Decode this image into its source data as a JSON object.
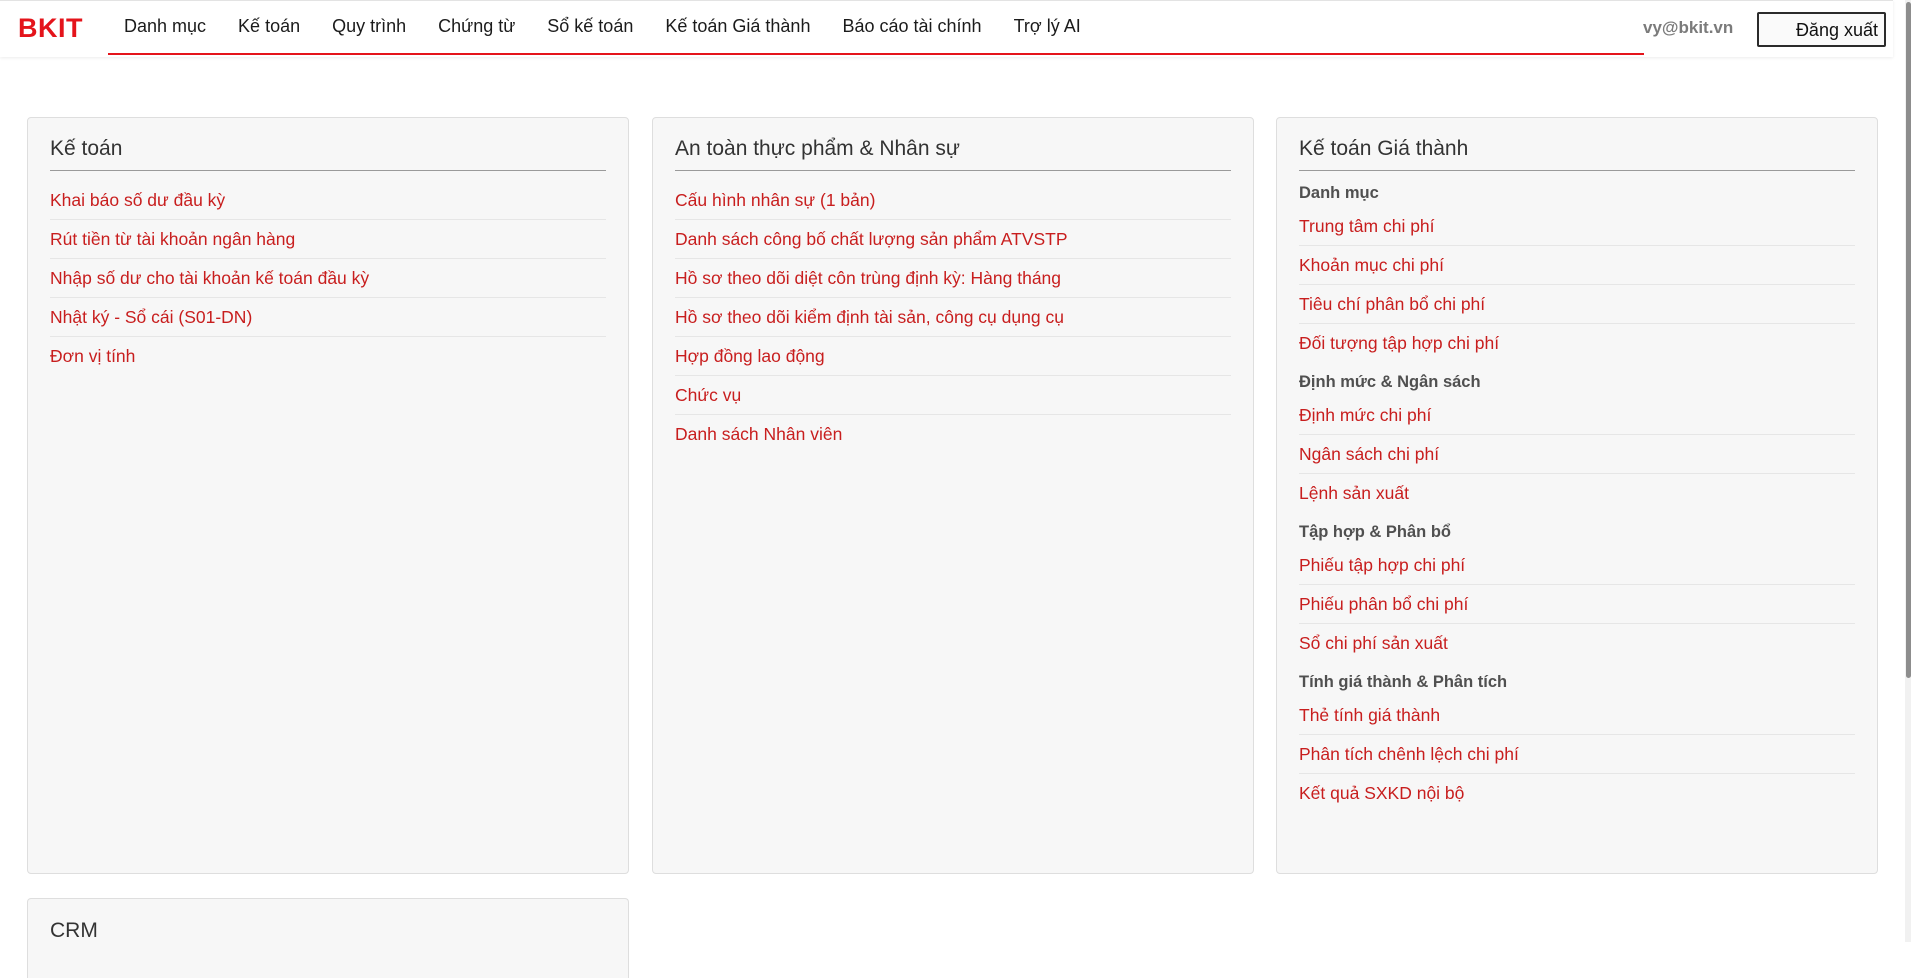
{
  "app": {
    "brand": "BKIT",
    "brand_color": "#e4141b",
    "link_color": "#c81e1e"
  },
  "nav": {
    "items": [
      {
        "label": "Danh mục"
      },
      {
        "label": "Kế toán"
      },
      {
        "label": "Quy trình"
      },
      {
        "label": "Chứng từ"
      },
      {
        "label": "Sổ kế toán"
      },
      {
        "label": "Kế toán Giá thành"
      },
      {
        "label": "Báo cáo tài chính"
      },
      {
        "label": "Trợ lý AI"
      }
    ],
    "user_email": "vy@bkit.vn",
    "logout_label": "Đăng xuất"
  },
  "cards": {
    "accounting": {
      "title": "Kế toán",
      "links": [
        "Khai báo số dư đầu kỳ",
        "Rút tiền từ tài khoản ngân hàng",
        "Nhập số dư cho tài khoản kế toán đầu kỳ",
        "Nhật ký - Sổ cái (S01-DN)",
        "Đơn vị tính"
      ]
    },
    "food_hr": {
      "title": "An toàn thực phẩm & Nhân sự",
      "links": [
        "Cấu hình nhân sự (1 bản)",
        "Danh sách công bố chất lượng sản phẩm ATVSTP",
        "Hồ sơ theo dõi diệt côn trùng định kỳ: Hàng tháng",
        "Hồ sơ theo dõi kiểm định tài sản, công cụ dụng cụ",
        "Hợp đồng lao động",
        "Chức vụ",
        "Danh sách Nhân viên"
      ]
    },
    "costing": {
      "title": "Kế toán Giá thành",
      "groups": [
        {
          "heading": "Danh mục",
          "links": [
            "Trung tâm chi phí",
            "Khoản mục chi phí",
            "Tiêu chí phân bổ chi phí",
            "Đối tượng tập hợp chi phí"
          ]
        },
        {
          "heading": "Định mức & Ngân sách",
          "links": [
            "Định mức chi phí",
            "Ngân sách chi phí",
            "Lệnh sản xuất"
          ]
        },
        {
          "heading": "Tập hợp & Phân bổ",
          "links": [
            "Phiếu tập hợp chi phí",
            "Phiếu phân bổ chi phí",
            "Sổ chi phí sản xuất"
          ]
        },
        {
          "heading": "Tính giá thành & Phân tích",
          "links": [
            "Thẻ tính giá thành",
            "Phân tích chênh lệch chi phí",
            "Kết quả SXKD nội bộ"
          ]
        }
      ]
    },
    "crm": {
      "title": "CRM"
    }
  }
}
